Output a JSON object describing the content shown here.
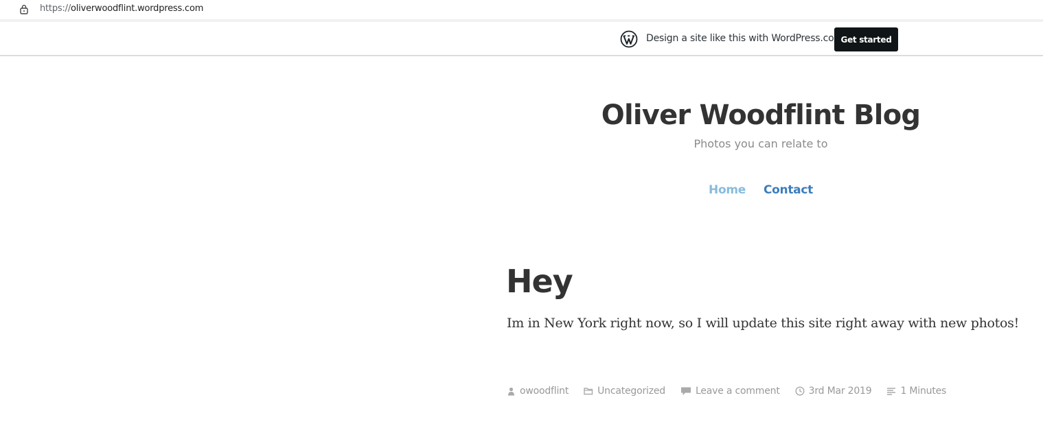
{
  "browser": {
    "url_scheme": "https://",
    "url_host": "oliverwoodflint.wordpress.com"
  },
  "promo": {
    "text": "Design a site like this with WordPress.com",
    "button_label": "Get started"
  },
  "site": {
    "title": "Oliver Woodflint Blog",
    "description": "Photos you can relate to"
  },
  "nav": {
    "items": [
      {
        "label": "Home"
      },
      {
        "label": "Contact"
      }
    ]
  },
  "post": {
    "title": "Hey",
    "body": "Im in New York right now, so I will update this site right away with new photos!",
    "meta": {
      "author": "owoodflint",
      "category": "Uncategorized",
      "comments": "Leave a comment",
      "date": "3rd Mar 2019",
      "reading_time": "1 Minutes"
    }
  },
  "colors": {
    "nav_active": "#88bbdd",
    "nav_link": "#3c7dbc",
    "button_bg": "#101517",
    "meta_text": "#999999"
  },
  "icons": {
    "lock": "lock-icon",
    "wordpress": "wordpress-logo-icon",
    "author": "user-icon",
    "category": "folder-icon",
    "comments": "comment-bubble-icon",
    "date": "clock-icon",
    "reading_time": "text-lines-icon"
  }
}
